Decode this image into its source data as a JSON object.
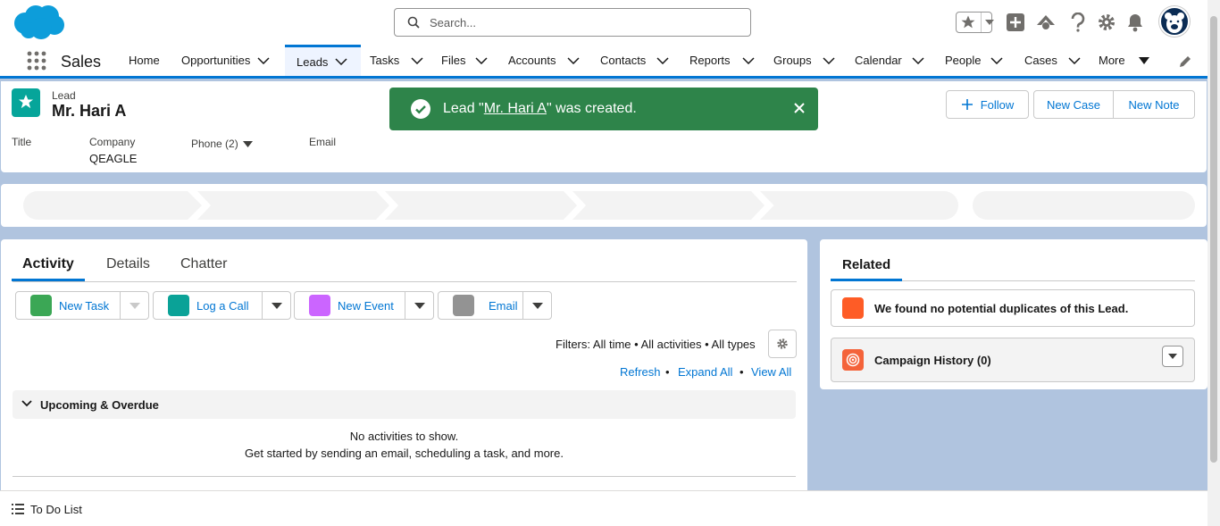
{
  "app": {
    "name": "Sales"
  },
  "search": {
    "placeholder": "Search..."
  },
  "nav": {
    "items": [
      {
        "label": "Home"
      },
      {
        "label": "Opportunities"
      },
      {
        "label": "Leads"
      },
      {
        "label": "Tasks"
      },
      {
        "label": "Files"
      },
      {
        "label": "Accounts"
      },
      {
        "label": "Contacts"
      },
      {
        "label": "Reports"
      },
      {
        "label": "Groups"
      },
      {
        "label": "Calendar"
      },
      {
        "label": "People"
      },
      {
        "label": "Cases"
      },
      {
        "label": "More"
      }
    ],
    "active": "Leads"
  },
  "record": {
    "object_label": "Lead",
    "name": "Mr. Hari A",
    "buttons": {
      "follow": "Follow",
      "new_case": "New Case",
      "new_note": "New Note"
    },
    "fields": {
      "title_label": "Title",
      "company_label": "Company",
      "company_value": "QEAGLE",
      "phone_label": "Phone (2)",
      "email_label": "Email"
    }
  },
  "toast": {
    "prefix": "Lead \"",
    "link": "Mr. Hari A",
    "suffix": "\" was created."
  },
  "activity": {
    "tabs": [
      "Activity",
      "Details",
      "Chatter"
    ],
    "actions": [
      {
        "label": "New Task",
        "color": "#3ba755"
      },
      {
        "label": "Log a Call",
        "color": "#0d9dda"
      },
      {
        "label": "New Event",
        "color": "#cb65ff"
      },
      {
        "label": "Email",
        "color": "#939393"
      }
    ],
    "filters": "Filters: All time • All activities • All types",
    "links": {
      "refresh": "Refresh",
      "expand_all": "Expand All",
      "view_all": "View All"
    },
    "section_title": "Upcoming & Overdue",
    "empty_line1": "No activities to show.",
    "empty_line2": "Get started by sending an email, scheduling a task, and more."
  },
  "related": {
    "tab": "Related",
    "duplicates": "We found no potential duplicates of this Lead.",
    "campaign_history": "Campaign History (0)"
  },
  "footer": {
    "todo": "To Do List"
  },
  "colors": {
    "brand": "#0176d3",
    "toast": "#2e844a",
    "lead_icon": "#06a59a"
  }
}
